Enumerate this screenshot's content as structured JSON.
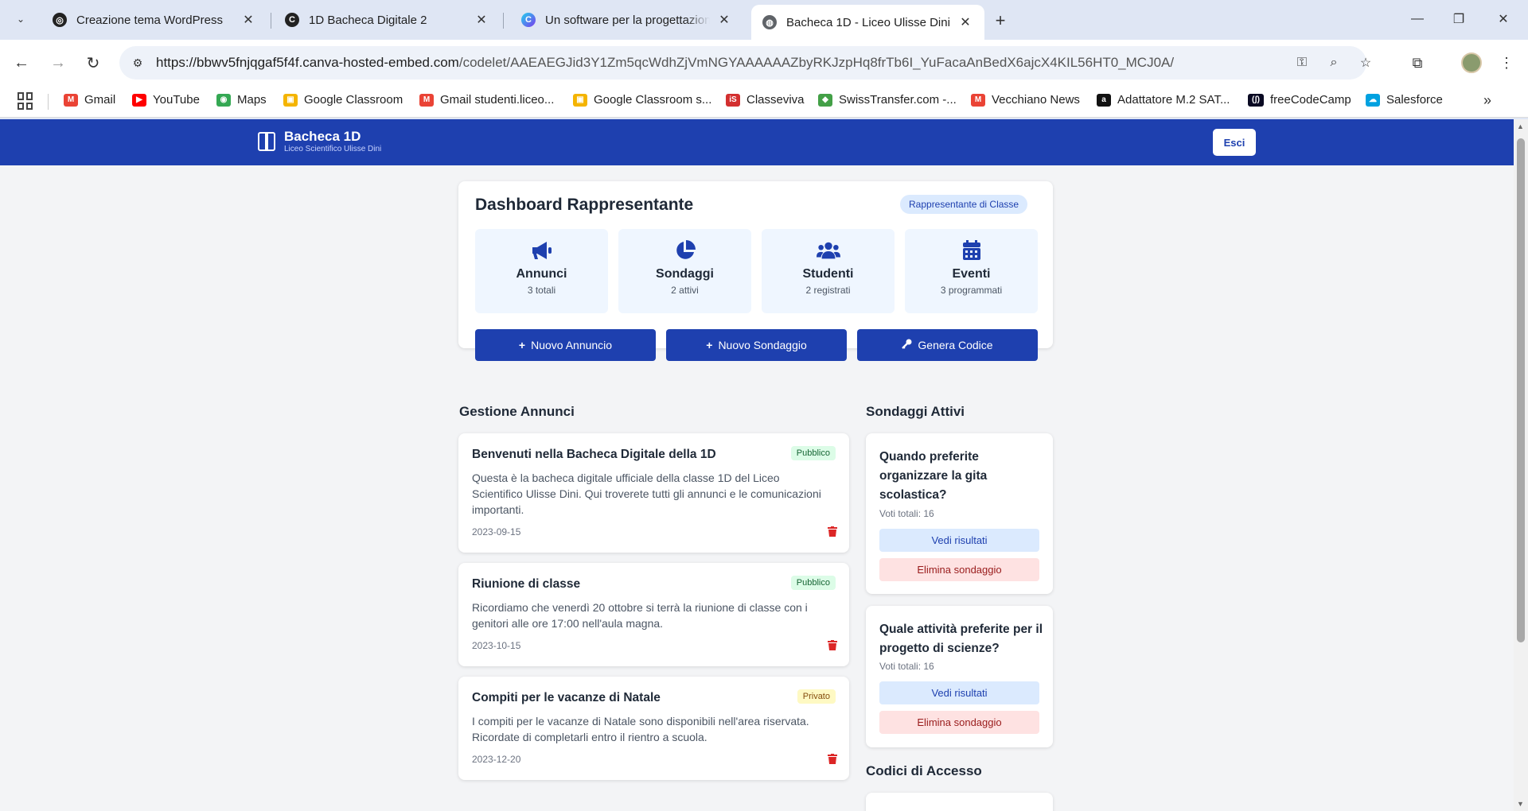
{
  "browser": {
    "tabs": [
      {
        "title": "Creazione tema WordPress",
        "favicon_color": "#222222"
      },
      {
        "title": "1D Bacheca Digitale 2",
        "favicon_color": "#222222"
      },
      {
        "title": "Un software per la progettazione",
        "favicon_color": "#7c3aed"
      },
      {
        "title": "Bacheca 1D - Liceo Ulisse Dini",
        "favicon_color": "#5f6368"
      }
    ],
    "url_host": "https://bbwv5fnjqgaf5f4f.canva-hosted-embed.com",
    "url_path": "/codelet/AAEAEGJid3Y1Zm5qcWdhZjVmNGYAAAAAAZbyRKJzpHq8frTb6I_YuFacaAnBedX6ajcX4KIL56HT0_MCJ0A/",
    "bookmarks": [
      {
        "label": "Gmail",
        "color": "#ea4335",
        "glyph": "M"
      },
      {
        "label": "YouTube",
        "color": "#ff0000",
        "glyph": "▶"
      },
      {
        "label": "Maps",
        "color": "#34a853",
        "glyph": "◉"
      },
      {
        "label": "Google Classroom",
        "color": "#f4b400",
        "glyph": "▣"
      },
      {
        "label": "Gmail studenti.liceo...",
        "color": "#ea4335",
        "glyph": "M"
      },
      {
        "label": "Google Classroom s...",
        "color": "#f4b400",
        "glyph": "▣"
      },
      {
        "label": "Classeviva",
        "color": "#d32f2f",
        "glyph": "iS"
      },
      {
        "label": "SwissTransfer.com -...",
        "color": "#43a047",
        "glyph": "◆"
      },
      {
        "label": "Vecchiano News",
        "color": "#ea4335",
        "glyph": "M"
      },
      {
        "label": "Adattatore M.2 SAT...",
        "color": "#111111",
        "glyph": "a"
      },
      {
        "label": "freeCodeCamp",
        "color": "#0a0a23",
        "glyph": "(🔥)"
      },
      {
        "label": "Salesforce",
        "color": "#00a1e0",
        "glyph": "☁"
      }
    ]
  },
  "app": {
    "brand_title": "Bacheca 1D",
    "brand_subtitle": "Liceo Scientifico Ulisse Dini",
    "logout_label": "Esci",
    "accent_color": "#1e40af"
  },
  "dashboard": {
    "title": "Dashboard Rappresentante",
    "role_badge": "Rappresentante di Classe",
    "stats": [
      {
        "icon": "megaphone-icon",
        "label": "Annunci",
        "sub": "3 totali"
      },
      {
        "icon": "pie-chart-icon",
        "label": "Sondaggi",
        "sub": "2 attivi"
      },
      {
        "icon": "users-icon",
        "label": "Studenti",
        "sub": "2 registrati"
      },
      {
        "icon": "calendar-icon",
        "label": "Eventi",
        "sub": "3 programmati"
      }
    ],
    "actions": [
      {
        "icon": "plus-icon",
        "label": "Nuovo Annuncio"
      },
      {
        "icon": "plus-icon",
        "label": "Nuovo Sondaggio"
      },
      {
        "icon": "key-icon",
        "label": "Genera Codice"
      }
    ]
  },
  "announcements": {
    "section_title": "Gestione Annunci",
    "items": [
      {
        "title": "Benvenuti nella Bacheca Digitale della 1D",
        "badge": "Pubblico",
        "body": "Questa è la bacheca digitale ufficiale della classe 1D del Liceo Scientifico Ulisse Dini. Qui troverete tutti gli annunci e le comunicazioni importanti.",
        "date": "2023-09-15"
      },
      {
        "title": "Riunione di classe",
        "badge": "Pubblico",
        "body": "Ricordiamo che venerdì 20 ottobre si terrà la riunione di classe con i genitori alle ore 17:00 nell'aula magna.",
        "date": "2023-10-15"
      },
      {
        "title": "Compiti per le vacanze di Natale",
        "badge": "Privato",
        "body": "I compiti per le vacanze di Natale sono disponibili nell'area riservata. Ricordate di completarli entro il rientro a scuola.",
        "date": "2023-12-20"
      }
    ]
  },
  "polls": {
    "section_title": "Sondaggi Attivi",
    "items": [
      {
        "question": "Quando preferite organizzare la gita scolastica?",
        "votes": "Voti totali: 16",
        "view_label": "Vedi risultati",
        "delete_label": "Elimina sondaggio"
      },
      {
        "question": "Quale attività preferite per il progetto di scienze?",
        "votes": "Voti totali: 16",
        "view_label": "Vedi risultati",
        "delete_label": "Elimina sondaggio"
      }
    ]
  },
  "access_codes": {
    "section_title": "Codici di Accesso"
  }
}
